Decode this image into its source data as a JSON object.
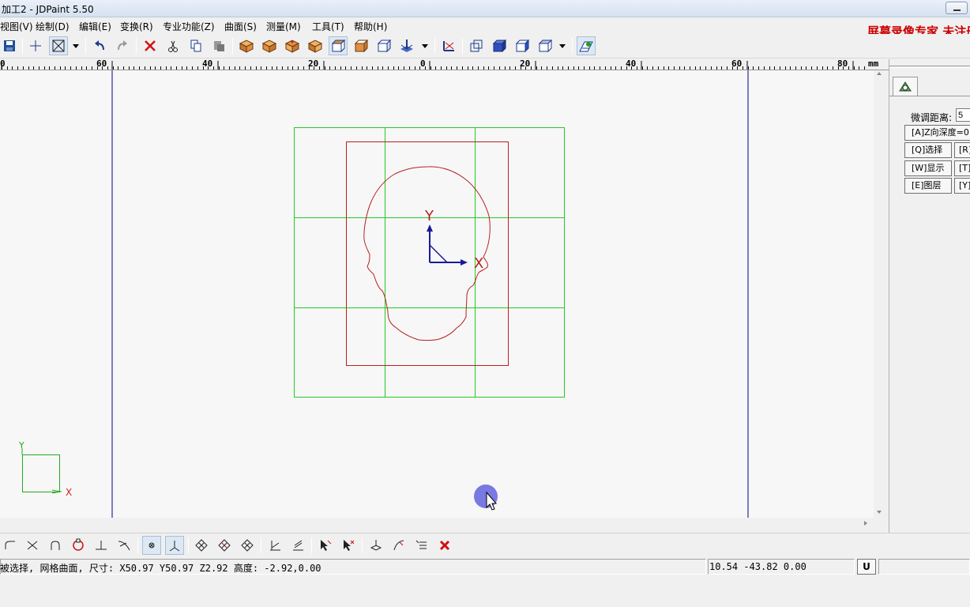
{
  "window": {
    "title": "加工2 - JDPaint 5.50"
  },
  "menu": [
    {
      "label": "视图(V)"
    },
    {
      "label": "绘制(D)"
    },
    {
      "label": "编辑(E)"
    },
    {
      "label": "变换(R)"
    },
    {
      "label": "专业功能(Z)"
    },
    {
      "label": "曲面(S)"
    },
    {
      "label": "测量(M)"
    },
    {
      "label": "工具(T)"
    },
    {
      "label": "帮助(H)"
    }
  ],
  "watermark": "屏幕录像专家 未注册",
  "toolbar_icons": [
    "save-icon",
    "crosshair-icon",
    "frame-icon",
    "dropdown-icon",
    "undo-icon",
    "redo-icon",
    "delete-icon",
    "cut-icon",
    "copy-icon",
    "paste-icon",
    "view-front-icon",
    "view-back-icon",
    "view-left-icon",
    "view-right-icon",
    "view-top-icon",
    "view-bottom-icon",
    "view-iso-icon",
    "view-axo-icon",
    "dropdown-icon",
    "axis-icon",
    "wire-icon",
    "solid-icon",
    "shaded-icon",
    "box-icon",
    "dropdown-icon",
    "layer-display-icon"
  ],
  "ruler": {
    "unit": "mm",
    "labels": [
      "0",
      "60",
      "40",
      "20",
      "0",
      "20",
      "40",
      "60",
      "80"
    ]
  },
  "canvas": {
    "axis_labels": {
      "y": "Y",
      "x": "X"
    },
    "corner_axis": {
      "y": "Y",
      "x": "X"
    }
  },
  "right_panel": {
    "fine_tune_label": "微调距离:",
    "fine_tune_value": "5",
    "z_depth_label": "[A]Z向深度=0",
    "buttons": [
      {
        "label": "[Q]选择",
        "side": "[R]"
      },
      {
        "label": "[W]显示",
        "side": "[T]"
      },
      {
        "label": "[E]图层",
        "side": "[Y]"
      }
    ]
  },
  "status": {
    "message": "被选择, 网格曲面, 尺寸: X50.97 Y50.97 Z2.92 高度: -2.92,0.00",
    "coords": "10.54 -43.82 0.00",
    "mode": "U"
  },
  "colors": {
    "grid_green": "#22cc22",
    "contour_red": "#b82020",
    "axis_blue": "#1a1a9a",
    "boundary_blue": "#2a2aa0",
    "watermark_red": "#cc0000"
  }
}
